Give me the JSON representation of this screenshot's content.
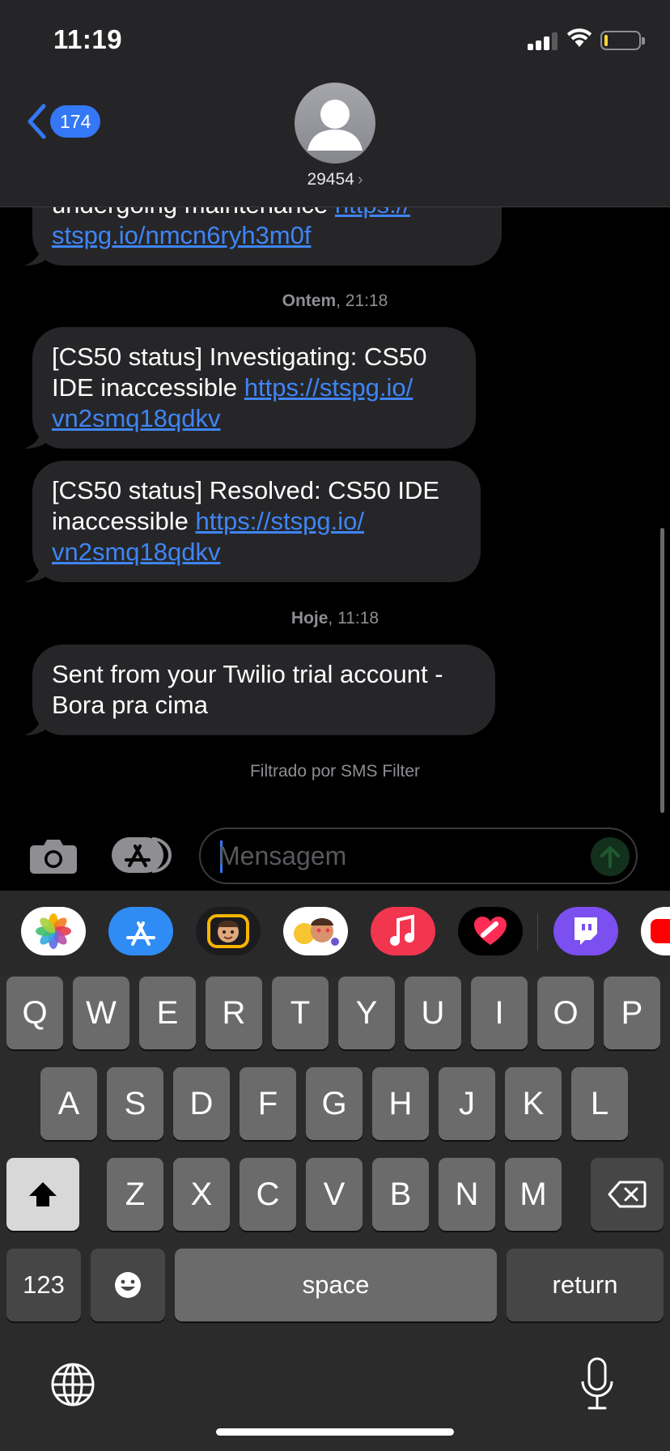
{
  "status_bar": {
    "time": "11:19"
  },
  "header": {
    "back_count": "174",
    "contact": "29454"
  },
  "thread": {
    "partial_message": {
      "text": "undergoing maintenance ",
      "link_a": "https://",
      "link_b": "stspg.io/nmcn6ryh3m0f"
    },
    "stamp_1": {
      "day": "Ontem",
      "time": ", 21:18"
    },
    "message_1": {
      "text": "[CS50 status] Investigating: CS50 IDE inaccessible ",
      "link_a": "https://stspg.io/",
      "link_b": "vn2smq18qdkv"
    },
    "message_2": {
      "text": "[CS50 status] Resolved: CS50 IDE inaccessible ",
      "link_a": "https://stspg.io/",
      "link_b": "vn2smq18qdkv"
    },
    "stamp_2": {
      "day": "Hoje",
      "time": ", 11:18"
    },
    "message_3": {
      "text": "Sent from your Twilio trial account - Bora pra cima"
    },
    "filter_note": "Filtrado por SMS Filter"
  },
  "compose": {
    "placeholder": "Mensagem"
  },
  "app_drawer": {
    "apps": [
      "photos-icon",
      "app-store-icon",
      "memoji-icon",
      "animoji-stickers-icon",
      "music-icon",
      "digital-touch-icon",
      "twitch-icon",
      "youtube-icon"
    ]
  },
  "keyboard": {
    "row1": [
      "Q",
      "W",
      "E",
      "R",
      "T",
      "Y",
      "U",
      "I",
      "O",
      "P"
    ],
    "row2": [
      "A",
      "S",
      "D",
      "F",
      "G",
      "H",
      "J",
      "K",
      "L"
    ],
    "row3": [
      "Z",
      "X",
      "C",
      "V",
      "B",
      "N",
      "M"
    ],
    "numbers": "123",
    "space": "space",
    "return": "return"
  },
  "colors": {
    "accent": "#3478f6",
    "bubble": "#262629",
    "link": "#3f85f5"
  }
}
